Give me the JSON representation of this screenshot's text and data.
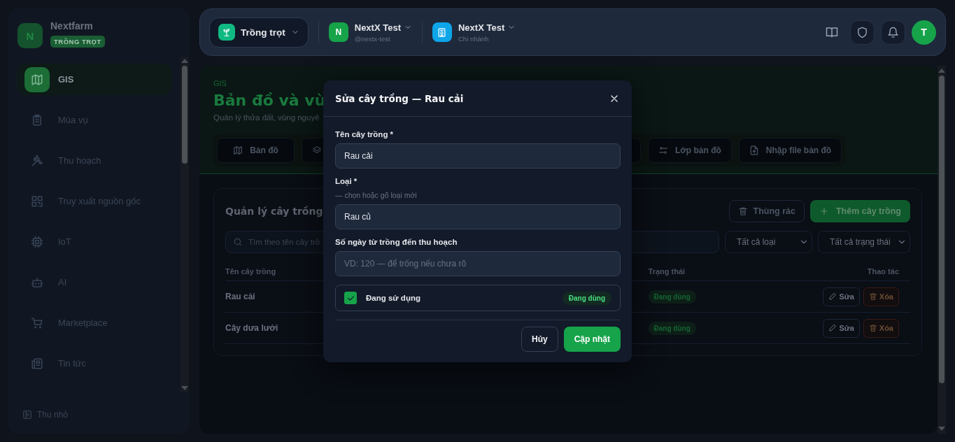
{
  "sidebar": {
    "brand": {
      "initial": "N",
      "name": "Nextfarm",
      "badge": "TRỒNG TRỌT"
    },
    "items": [
      {
        "label": "GIS",
        "selected": true
      },
      {
        "label": "Mùa vụ",
        "selected": false
      },
      {
        "label": "Thu hoạch",
        "selected": false
      },
      {
        "label": "Truy xuất nguồn gốc",
        "selected": false
      },
      {
        "label": "IoT",
        "selected": false
      },
      {
        "label": "AI",
        "selected": false
      },
      {
        "label": "Marketplace",
        "selected": false
      },
      {
        "label": "Tin tức",
        "selected": false
      }
    ],
    "collapse": "Thu nhỏ"
  },
  "topbar": {
    "module": "Trồng trọt",
    "org": {
      "initial": "N",
      "name": "NextX Test",
      "handle": "@nextx-test"
    },
    "branch": {
      "name": "NextX Test",
      "subtitle": "Chi nhánh"
    },
    "user_initial": "T"
  },
  "page": {
    "breadcrumb": "GIS",
    "title": "Bản đồ và vù",
    "subtitle": "Quản lý thửa đất, vùng nguyê",
    "tabs": [
      {
        "label": "Bản đồ"
      },
      {
        "kind": "hidden"
      },
      {
        "label": "Lớp bản đồ"
      },
      {
        "label": "Nhập file bản đồ"
      }
    ]
  },
  "card": {
    "title": "Quản lý cây trồng",
    "trash_button": "Thùng rác",
    "add_button": "Thêm cây trồng",
    "search": {
      "placeholder": "Tìm theo tên cây trồ"
    },
    "filters": [
      "Tất cả loại",
      "Tất cả trạng thái"
    ],
    "columns": [
      "Tên cây trồng",
      "Trạng thái",
      "Thao tác"
    ],
    "rows": [
      {
        "name": "Rau cải",
        "status": "Đang dùng",
        "edit": "Sửa",
        "delete": "Xóa"
      },
      {
        "name": "Cây dưa lưới",
        "status": "Đang dùng",
        "edit": "Sửa",
        "delete": "Xóa"
      }
    ]
  },
  "modal": {
    "title": "Sửa cây trồng — Rau cải",
    "fields": [
      {
        "label": "Tên cây trồng *",
        "value": "Rau cải"
      },
      {
        "label": "Loại *",
        "hint": "— chọn hoặc gõ loại mới",
        "value": "Rau củ"
      },
      {
        "label": "Số ngày từ trồng đến thu hoạch",
        "placeholder": "VD: 120 — để trống nếu chưa rõ"
      }
    ],
    "checkbox": {
      "label": "Đang sử dụng",
      "checked": true,
      "badge": "Đang dùng"
    },
    "cancel": "Hủy",
    "submit": "Cập nhật"
  }
}
